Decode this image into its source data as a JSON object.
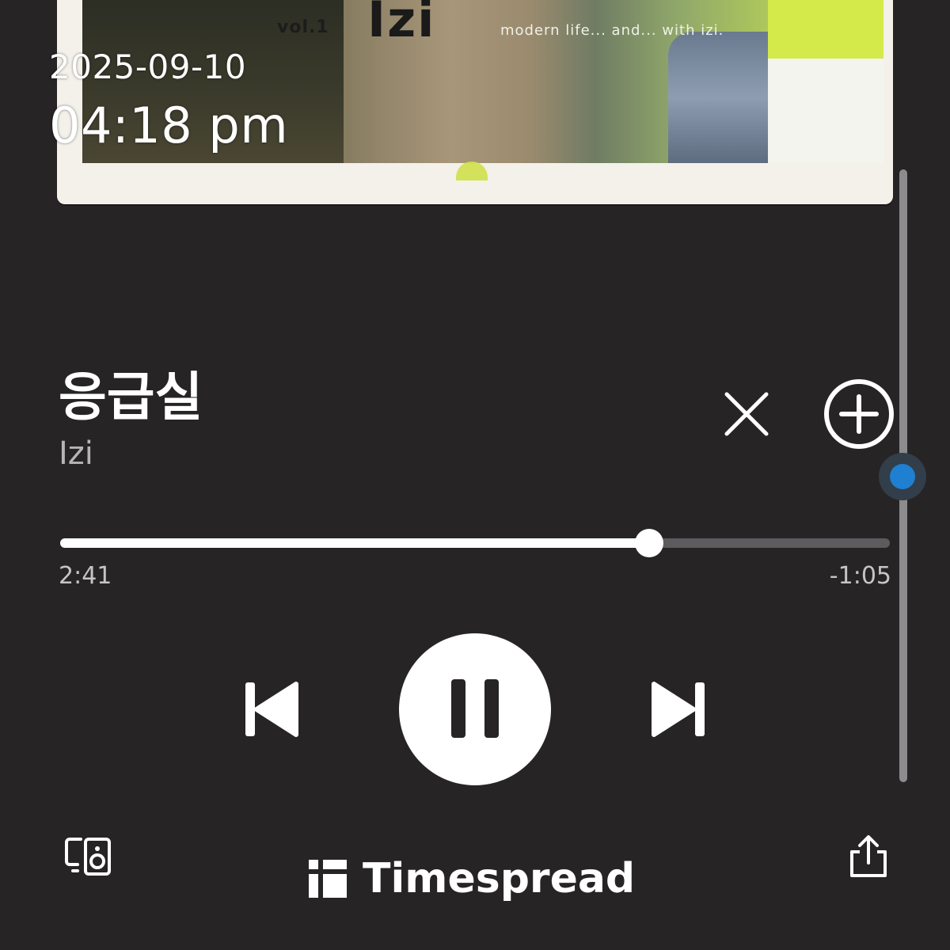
{
  "album_art": {
    "vol_label": "vol.1",
    "title_text": "Izi",
    "tagline": "modern life... and... with izi."
  },
  "timestamp": {
    "date": "2025-09-10",
    "time": "04:18 pm"
  },
  "track": {
    "title": "응급실",
    "artist": "Izi"
  },
  "playback": {
    "elapsed": "2:41",
    "remaining": "-1:05",
    "progress_fraction": 0.71,
    "state": "playing"
  },
  "controls": {
    "remove_icon": "close-icon",
    "add_icon": "plus-circle-icon",
    "previous_icon": "skip-previous-icon",
    "pause_icon": "pause-icon",
    "next_icon": "skip-next-icon",
    "devices_icon": "devices-icon",
    "share_icon": "share-icon"
  },
  "watermark": {
    "text": "Timespread"
  },
  "colors": {
    "background": "#272426",
    "accent_knob": "#1f7fd0"
  }
}
